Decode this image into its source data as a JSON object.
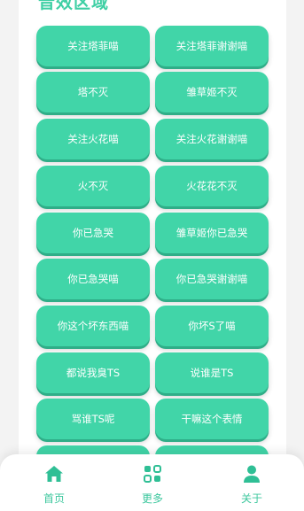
{
  "section": {
    "title": "音效区域"
  },
  "buttons": [
    "关注塔菲喵",
    "关注塔菲谢谢喵",
    "塔不灭",
    "雏草姬不灭",
    "关注火花喵",
    "关注火花谢谢喵",
    "火不灭",
    "火花花不灭",
    "你已急哭",
    "雏草姬你已急哭",
    "你已急哭喵",
    "你已急哭谢谢喵",
    "你这个坏东西喵",
    "你坏S了喵",
    "都说我臭TS",
    "说谁是TS",
    "骂谁TS呢",
    "干嘛这个表情",
    "",
    ""
  ],
  "tabbar": {
    "home": {
      "label": "首页",
      "icon": "home-icon"
    },
    "more": {
      "label": "更多",
      "icon": "more-icon"
    },
    "about": {
      "label": "关于",
      "icon": "user-icon"
    }
  },
  "colors": {
    "accent": "#41d5a8",
    "accent_dark": "#2fae88",
    "tab": "#3cc79d"
  }
}
